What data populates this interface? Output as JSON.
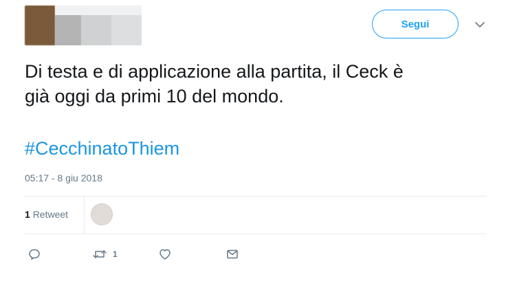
{
  "header": {
    "follow_label": "Segui"
  },
  "tweet": {
    "text": "Di testa e di applicazione alla partita, il Ceck è\ngià oggi da primi 10 del mondo.",
    "hashtag": "#CecchinatoThiem",
    "timestamp": "05:17 - 8 giu 2018"
  },
  "stats": {
    "retweet_count": "1",
    "retweet_label": "Retweet"
  },
  "actions": {
    "reply_icon": "reply-icon",
    "retweet_icon": "retweet-icon",
    "retweet_count": "1",
    "like_icon": "heart-icon",
    "dm_icon": "envelope-icon"
  },
  "colors": {
    "accent": "#1da1f2",
    "hashtag": "#1b95e0",
    "text": "#14171a",
    "muted": "#657786",
    "divider": "#e6ecf0"
  }
}
